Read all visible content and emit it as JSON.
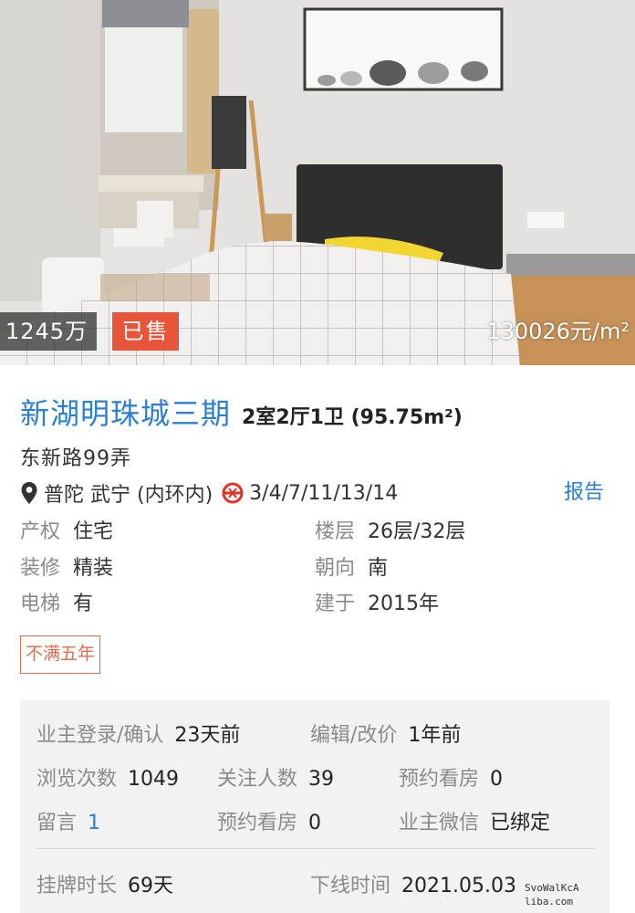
{
  "hero": {
    "total_price": "1245万",
    "sold_label": "已售",
    "unit_price": "130026元/m²"
  },
  "listing": {
    "title": "新湖明珠城三期",
    "layout": "2室2厅1卫 (95.75m²)",
    "address": "东新路99弄",
    "district": "普陀 武宁 (内环内)",
    "metro_lines": "3/4/7/11/13/14",
    "report_label": "报告"
  },
  "attributes": {
    "property_rights": {
      "label": "产权",
      "value": "住宅"
    },
    "floor": {
      "label": "楼层",
      "value": "26层/32层"
    },
    "decoration": {
      "label": "装修",
      "value": "精装"
    },
    "orientation": {
      "label": "朝向",
      "value": "南"
    },
    "elevator": {
      "label": "电梯",
      "value": "有"
    },
    "built": {
      "label": "建于",
      "value": "2015年"
    }
  },
  "tag": "不满五年",
  "stats": {
    "owner_confirm": {
      "label": "业主登录/确认",
      "value": "23天前"
    },
    "edit_price": {
      "label": "编辑/改价",
      "value": "1年前"
    },
    "views": {
      "label": "浏览次数",
      "value": "1049"
    },
    "followers": {
      "label": "关注人数",
      "value": "39"
    },
    "viewing_appt_1": {
      "label": "预约看房",
      "value": "0"
    },
    "messages": {
      "label": "留言",
      "value": "1"
    },
    "viewing_appt_2": {
      "label": "预约看房",
      "value": "0"
    },
    "owner_wechat": {
      "label": "业主微信",
      "value": "已绑定"
    },
    "listing_duration": {
      "label": "挂牌时长",
      "value": "69天"
    },
    "offline_time": {
      "label": "下线时间",
      "value": "2021.05.03"
    }
  },
  "watermark": {
    "line1": "SvoWalKcA",
    "line2": "liba.com"
  },
  "colors": {
    "accent_blue": "#2a7fd1",
    "sold_red": "#e8553a",
    "tag_orange": "#e36a4a"
  },
  "icons": {
    "location": "location-pin-icon",
    "metro": "metro-logo-icon"
  }
}
